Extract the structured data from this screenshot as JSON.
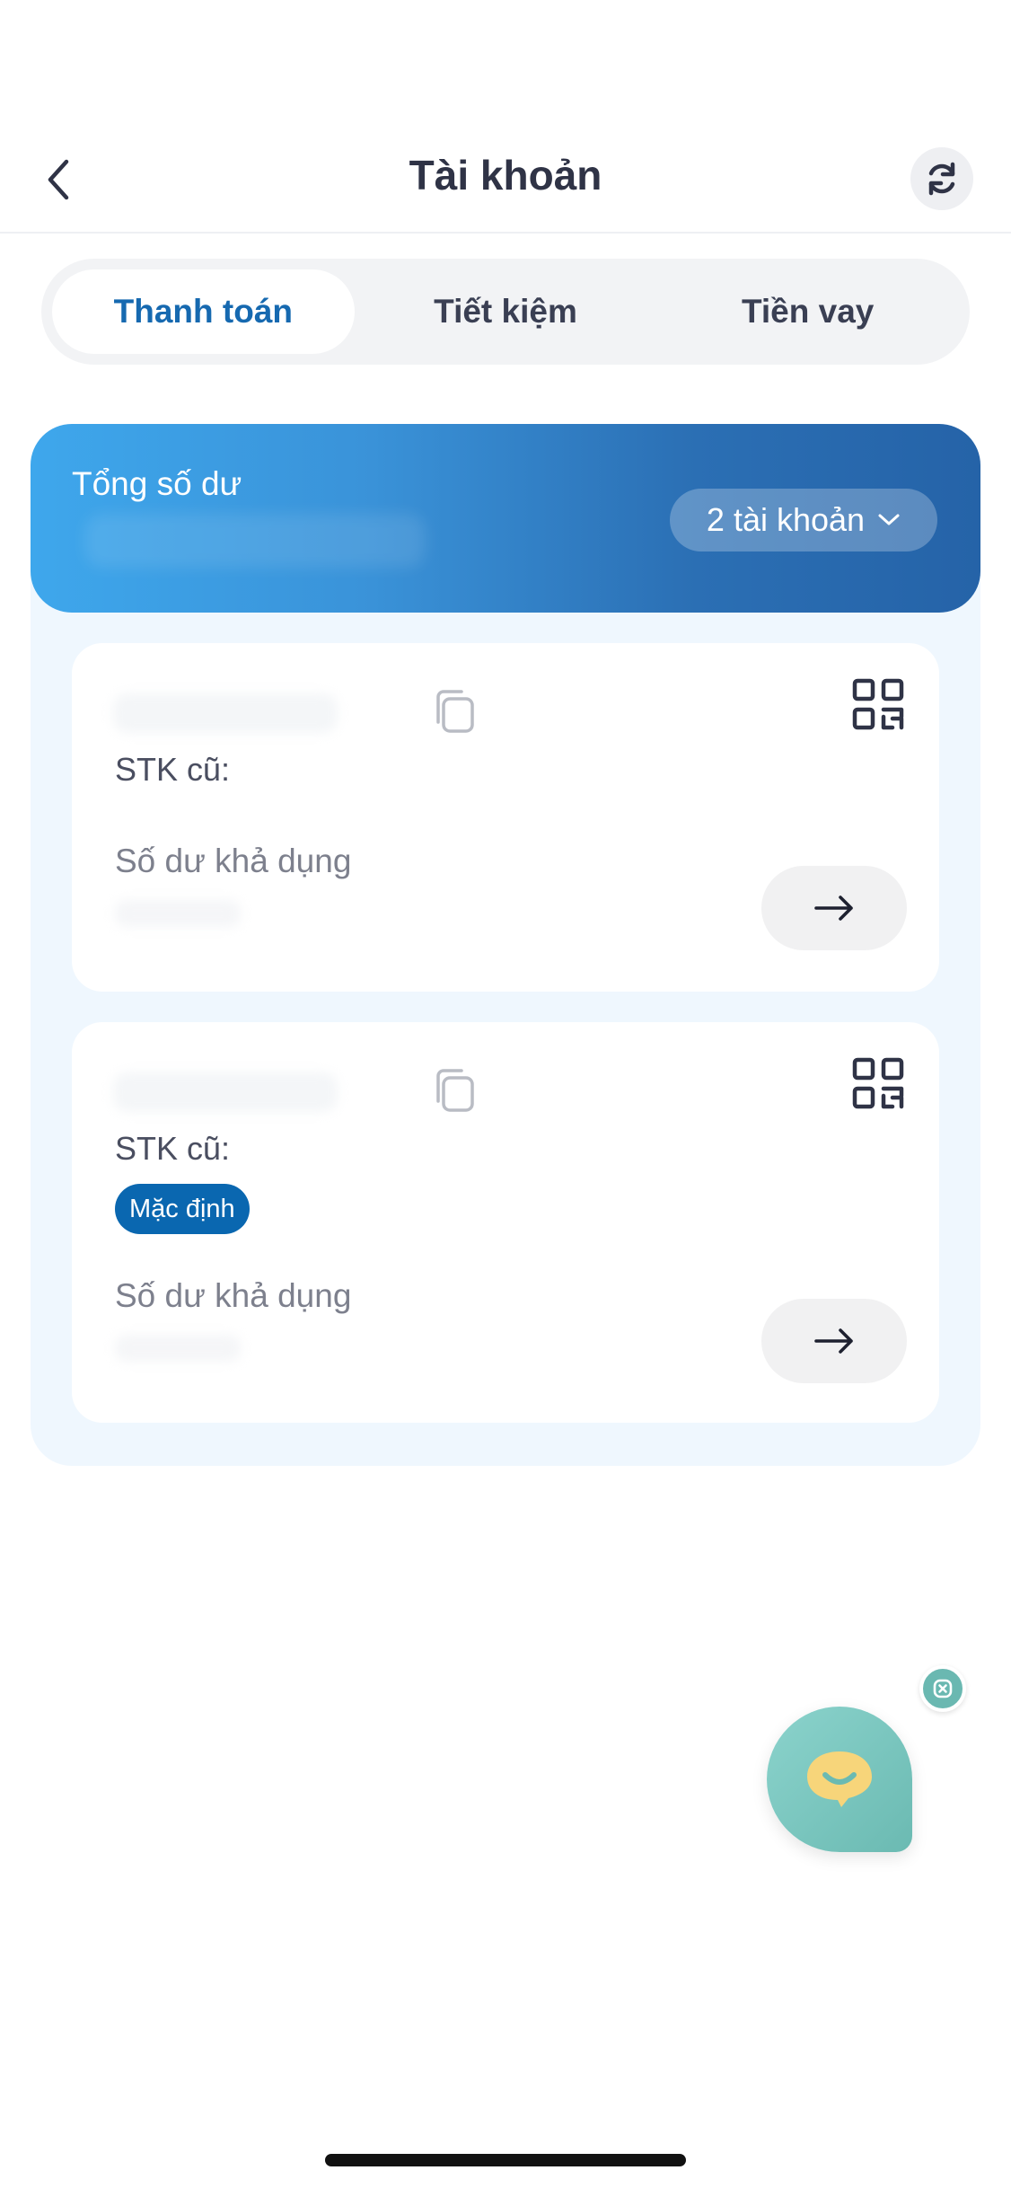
{
  "header": {
    "title": "Tài khoản"
  },
  "tabs": [
    {
      "label": "Thanh toán",
      "active": true
    },
    {
      "label": "Tiết kiệm",
      "active": false
    },
    {
      "label": "Tiền vay",
      "active": false
    }
  ],
  "balance": {
    "label": "Tổng số dư",
    "account_count_label": "2 tài khoản"
  },
  "accounts": [
    {
      "old_account_label": "STK cũ:",
      "available_balance_label": "Số dư khả dụng",
      "is_default": false
    },
    {
      "old_account_label": "STK cũ:",
      "default_badge": "Mặc định",
      "available_balance_label": "Số dư khả dụng",
      "is_default": true
    }
  ],
  "icons": {
    "back": "chevron-left-icon",
    "refresh": "refresh-icon",
    "copy": "copy-icon",
    "qr": "qr-code-icon",
    "arrow": "arrow-right-icon",
    "chat": "chat-icon",
    "close": "close-icon"
  },
  "colors": {
    "primary": "#1669b0",
    "badge": "#0a67b0",
    "card_bg": "#eff7fe",
    "chat": "#6bbab2"
  }
}
